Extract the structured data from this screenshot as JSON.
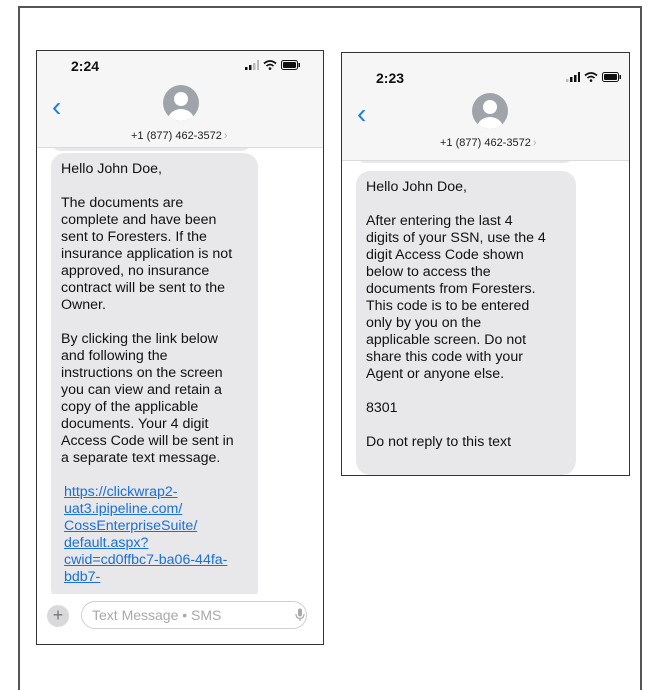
{
  "phone1": {
    "time": "2:24",
    "contact": "+1 (877) 462-3572",
    "message": {
      "greeting": "Hello John Doe,",
      "para1": "The documents are\ncomplete and have been\nsent to Foresters. If the\ninsurance application is not\napproved, no insurance\ncontract will be sent to the\nOwner.",
      "para2": "By clicking the link below\nand following the\ninstructions on the screen\nyou can view and retain a\ncopy of the applicable\ndocuments. Your 4 digit\nAccess Code will be sent in\na separate text message.",
      "link": "https://clickwrap2-\nuat3.ipipeline.com/\nCossEnterpriseSuite/\ndefault.aspx?\ncwid=cd0ffbc7-ba06-44fa-\nbdb7-"
    },
    "composer_placeholder": "Text Message • SMS"
  },
  "phone2": {
    "time": "2:23",
    "contact": "+1 (877) 462-3572",
    "message": {
      "greeting": "Hello John Doe,",
      "para1": "After entering the last 4\ndigits of your SSN, use the 4\ndigit Access Code shown\nbelow to access the\ndocuments from Foresters.\nThis code is to be entered\nonly by you on the\napplicable screen. Do not\nshare this code with your\nAgent or anyone else.",
      "code": "8301",
      "footer": "Do not reply to this text"
    }
  },
  "colors": {
    "link": "#1a6fd8",
    "back_chevron": "#1a7ee8",
    "bubble": "#e8e8ea"
  },
  "icons": [
    "back-chevron-icon",
    "avatar-icon",
    "signal-icon",
    "wifi-icon",
    "battery-icon",
    "plus-icon",
    "mic-icon"
  ]
}
